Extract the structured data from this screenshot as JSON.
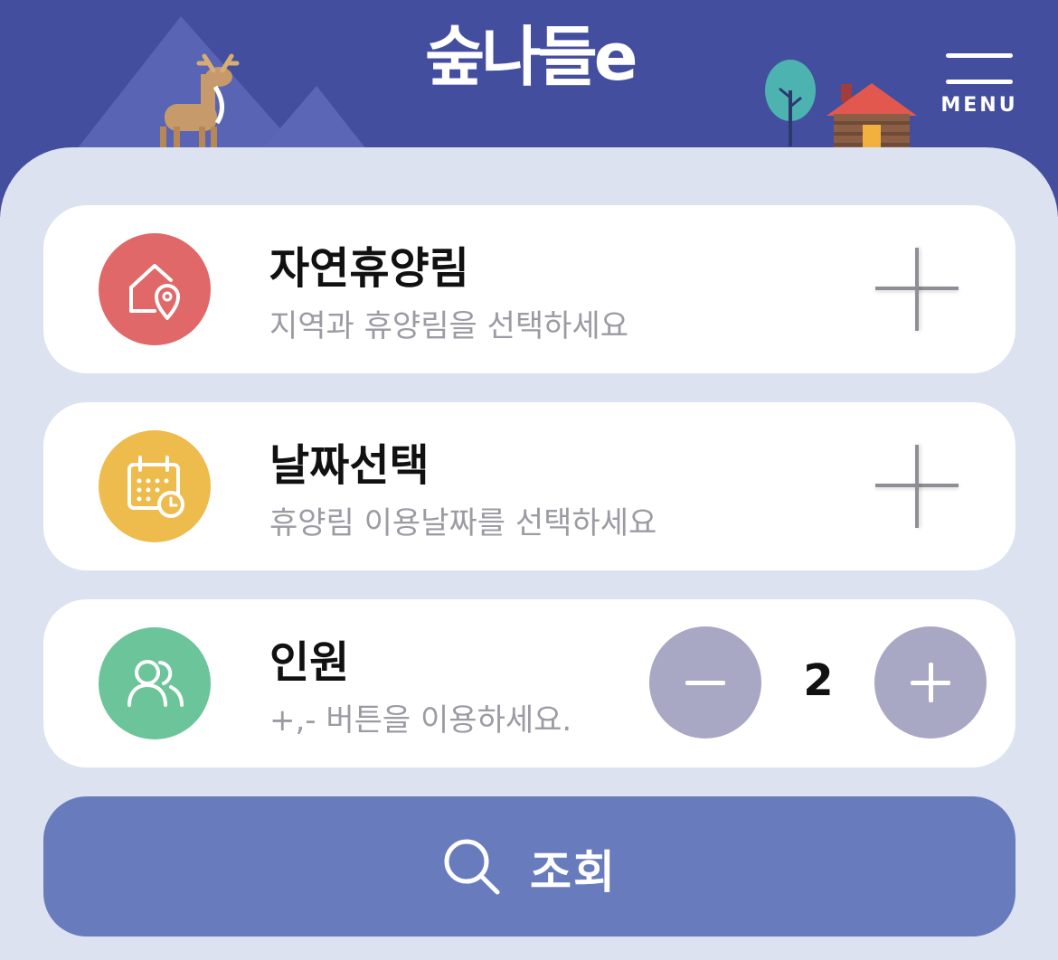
{
  "header": {
    "logo_text": "숲나들e",
    "menu_label": "MENU"
  },
  "forest": {
    "title": "자연휴양림",
    "subtitle": "지역과 휴양림을 선택하세요",
    "icon": "house-location-icon",
    "color": "#e06868"
  },
  "date": {
    "title": "날짜선택",
    "subtitle": "휴양림 이용날짜를 선택하세요",
    "icon": "calendar-clock-icon",
    "color": "#eebb4d"
  },
  "people": {
    "title": "인원",
    "subtitle": "+,- 버튼을 이용하세요.",
    "count": "2",
    "icon": "users-icon",
    "color": "#6cc49a"
  },
  "search": {
    "label": "조회",
    "icon": "search-icon",
    "color": "#687cbd"
  }
}
